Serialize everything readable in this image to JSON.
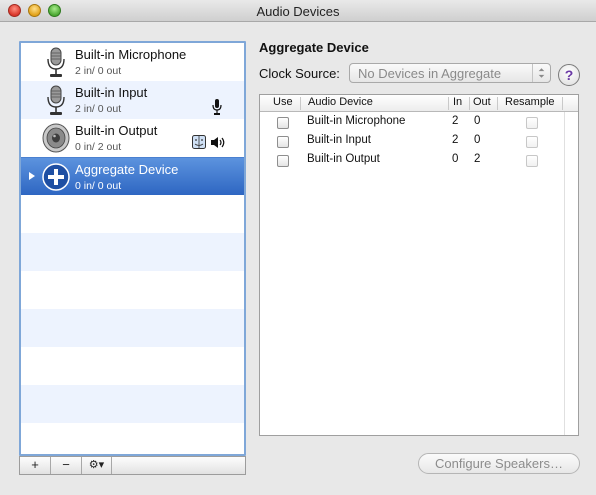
{
  "window": {
    "title": "Audio Devices"
  },
  "devices": [
    {
      "name": "Built-in Microphone",
      "io": "2 in/ 0 out",
      "icon": "microphone-icon"
    },
    {
      "name": "Built-in Input",
      "io": "2 in/ 0 out",
      "icon": "microphone-icon",
      "badge": "microphone-icon"
    },
    {
      "name": "Built-in Output",
      "io": "0 in/ 2 out",
      "icon": "speaker-icon",
      "badge": "finder-speaker-icons"
    },
    {
      "name": "Aggregate Device",
      "io": "0 in/ 0 out",
      "icon": "aggregate-plus-icon",
      "selected": true
    }
  ],
  "list_bar": {
    "add": "+",
    "remove": "−",
    "actions": "⚙▾"
  },
  "detail": {
    "heading": "Aggregate Device",
    "clock_label": "Clock Source:",
    "clock_value": "No Devices in Aggregate",
    "help": "?",
    "table": {
      "columns": [
        "Use",
        "Audio Device",
        "In",
        "Out",
        "Resample"
      ],
      "rows": [
        {
          "device": "Built-in Microphone",
          "in": "2",
          "out": "0"
        },
        {
          "device": "Built-in Input",
          "in": "2",
          "out": "0"
        },
        {
          "device": "Built-in Output",
          "in": "0",
          "out": "2"
        }
      ]
    },
    "configure_button": "Configure Speakers…"
  },
  "colors": {
    "selection": "#3a74cf",
    "list_focus_border": "#7fa7d8",
    "row_stripe": "#edf3fe"
  }
}
